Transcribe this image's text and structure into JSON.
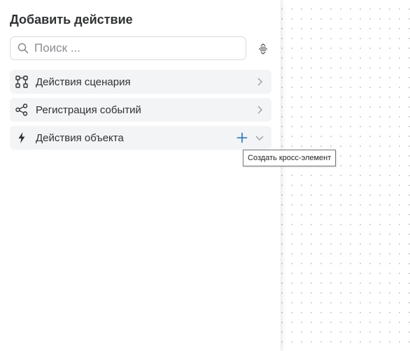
{
  "panel": {
    "title": "Добавить действие",
    "search": {
      "placeholder": "Поиск ..."
    },
    "filter_icon": "sort-collapse-icon",
    "groups": [
      {
        "label": "Действия сценария",
        "icon": "flow-nodes-icon",
        "expanded": false
      },
      {
        "label": "Регистрация событий",
        "icon": "share-nodes-icon",
        "expanded": false
      },
      {
        "label": "Действия объекта",
        "icon": "lightning-icon",
        "expanded": false
      }
    ]
  },
  "tooltip": {
    "text": "Создать кросс-элемент"
  },
  "colors": {
    "accent": "#3b7fc4",
    "group_bg": "#f3f4f6",
    "text": "#2f3133"
  }
}
